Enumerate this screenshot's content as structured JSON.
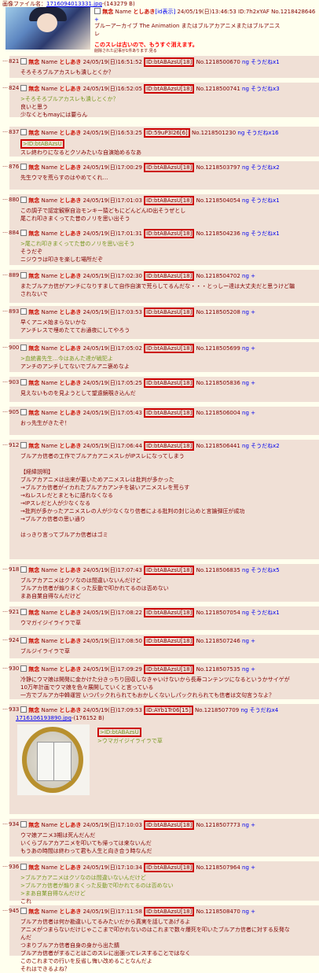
{
  "top": {
    "file_label": "画像ファイル名：",
    "file_link": "1716094013331.jpg",
    "file_size": "-(143279 B)"
  },
  "op": {
    "checkbox": "",
    "subject": "無念",
    "name_label": "Name",
    "name": "としあき",
    "id_show": "[id表示]",
    "datetime": "24/05/19(日)13:46:53",
    "id": "ID:7h2xYAF",
    "no": "No.1218428646",
    "sodane": "+",
    "body_line1": "ブルーアーカイブ The Animation またはブルアカアニメまたはブルアニス",
    "body_line2": "レ",
    "warning": "このスレは古いので、もうすぐ消えます。",
    "small_note": "削除された記事が1件あります.見る"
  },
  "posts": [
    {
      "dots": "…",
      "num": "821",
      "subject": "無念",
      "name_label": "Name",
      "name": "としあき",
      "datetime": "24/05/19(日)16:51:52",
      "id": "ID:btABAzsU[18]",
      "no": "No.1218500670",
      "sodane": "ng",
      "sodane_label": "そうだねx1",
      "lines": [
        {
          "t": "そろそろブルアカスレも潰しとくか？",
          "q": false
        }
      ]
    },
    {
      "dots": "…",
      "num": "824",
      "subject": "無念",
      "name_label": "Name",
      "name": "としあき",
      "datetime": "24/05/19(日)16:52:05",
      "id": "ID:btABAzsU[18]",
      "no": "No.1218500741",
      "sodane": "ng",
      "sodane_label": "そうだねx3",
      "lines": [
        {
          "t": ">そろそろブルアカスレも潰しとくか？",
          "q": true
        },
        {
          "t": "良いと思う",
          "q": false
        },
        {
          "t": "少なくともmayには要らん",
          "q": false
        }
      ]
    },
    {
      "dots": "…",
      "num": "837",
      "subject": "無念",
      "name_label": "Name",
      "name": "としあき",
      "datetime": "24/05/19(日)16:53:25",
      "id": "ID:59uP3l26[6]",
      "no": "No.1218501230",
      "sodane": "ng",
      "sodane_label": "そうだねx16",
      "quote_id": ">ID:btABAzsU",
      "lines": [
        {
          "t": "スレ終わりになるとクソみたいな自演始めるなあ",
          "q": false
        }
      ]
    },
    {
      "dots": "…",
      "num": "876",
      "subject": "無念",
      "name_label": "Name",
      "name": "としあき",
      "datetime": "24/05/19(日)17:00:29",
      "id": "ID:btABAzsU[18]",
      "no": "No.1218503797",
      "sodane": "ng",
      "sodane_label": "そうだねx2",
      "lines": [
        {
          "t": "先生ウマを荒らすのはやめてくれ…",
          "q": false
        }
      ]
    },
    {
      "dots": "…",
      "num": "880",
      "subject": "無念",
      "name_label": "Name",
      "name": "としあき",
      "datetime": "24/05/19(日)17:01:03",
      "id": "ID:btABAzsU[18]",
      "no": "No.1218504054",
      "sodane": "ng",
      "sodane_label": "そうだねx1",
      "lines": [
        {
          "t": "この調子で認定観察自治モンキー猿どもにどんどんID出そうぜとし",
          "q": false
        },
        {
          "t": "尾これ叩きまくってた昔のノリを思い出そう",
          "q": false
        }
      ]
    },
    {
      "dots": "…",
      "num": "884",
      "subject": "無念",
      "name_label": "Name",
      "name": "としあき",
      "datetime": "24/05/19(日)17:01:31",
      "id": "ID:btABAzsU[18]",
      "no": "No.1218504236",
      "sodane": "ng",
      "sodane_label": "そうだねx1",
      "lines": [
        {
          "t": ">尾これ叩きまくってた昔のノリを思い出そう",
          "q": true
        },
        {
          "t": "そうだぞ",
          "q": false
        },
        {
          "t": "ニジウラは叩きを楽しむ場所だぞ",
          "q": false
        }
      ]
    },
    {
      "dots": "…",
      "num": "889",
      "subject": "無念",
      "name_label": "Name",
      "name": "としあき",
      "datetime": "24/05/19(日)17:02:30",
      "id": "ID:btABAzsU[18]",
      "no": "No.1218504702",
      "sodane": "ng",
      "sodane_label": "+",
      "lines": [
        {
          "t": "またブルアカ信がアンチになりすまして自作自演で荒らしてるんだな・・・とっしー達は大丈夫だと思うけど騙",
          "q": false
        },
        {
          "t": "されないで",
          "q": false
        }
      ]
    },
    {
      "dots": "…",
      "num": "893",
      "subject": "無念",
      "name_label": "Name",
      "name": "としあき",
      "datetime": "24/05/19(日)17:03:53",
      "id": "ID:btABAzsU[18]",
      "no": "No.1218505208",
      "sodane": "ng",
      "sodane_label": "+",
      "lines": [
        {
          "t": "早くアニメ始まらないかな",
          "q": false
        },
        {
          "t": "アンチレスで埋めたててお通夜にしてやろう",
          "q": false
        }
      ]
    },
    {
      "dots": "…",
      "num": "900",
      "subject": "無念",
      "name_label": "Name",
      "name": "としあき",
      "datetime": "24/05/19(日)17:05:02",
      "id": "ID:btABAzsU[18]",
      "no": "No.1218505699",
      "sodane": "ng",
      "sodane_label": "+",
      "lines": [
        {
          "t": ">血統書先生…今はあんた達が戦犯よ",
          "q": true
        },
        {
          "t": "アンチのアンチしてないでブルアニ褒めなよ",
          "q": false
        }
      ]
    },
    {
      "dots": "…",
      "num": "903",
      "subject": "無念",
      "name_label": "Name",
      "name": "としあき",
      "datetime": "24/05/19(日)17:05:25",
      "id": "ID:btABAzsU[18]",
      "no": "No.1218505836",
      "sodane": "ng",
      "sodane_label": "+",
      "lines": [
        {
          "t": "見えないものを見ようとして望遠鏡覗き込んだ",
          "q": false
        }
      ]
    },
    {
      "dots": "…",
      "num": "905",
      "subject": "無念",
      "name_label": "Name",
      "name": "としあき",
      "datetime": "24/05/19(日)17:05:43",
      "id": "ID:btABAzsU[18]",
      "no": "No.1218506004",
      "sodane": "ng",
      "sodane_label": "+",
      "lines": [
        {
          "t": "おっ先生がきたぞ！",
          "q": false
        }
      ]
    },
    {
      "dots": "…",
      "num": "912",
      "subject": "無念",
      "name_label": "Name",
      "name": "としあき",
      "datetime": "24/05/19(日)17:06:44",
      "id": "ID:btABAzsU[18]",
      "no": "No.1218506441",
      "sodane": "ng",
      "sodane_label": "そうだねx2",
      "lines": [
        {
          "t": "ブルアカ信者の工作でブルアカアニメスレがIPスレになってしまう",
          "q": false
        },
        {
          "t": "",
          "q": false
        },
        {
          "t": "【経緯説明】",
          "q": false
        },
        {
          "t": "ブルアカアニメは出来が悪いためアニメスレは批判が多かった",
          "q": false
        },
        {
          "t": "→ブルアカ信者がイカれたブルアカアンチを装いアニメスレを荒らす",
          "q": false
        },
        {
          "t": "→ねレスレだとまともに語れなくなる",
          "q": false
        },
        {
          "t": "→IPスレだと人が少なくなる",
          "q": false
        },
        {
          "t": "→批判が多かったアニメスレの人が少なくなり信者による批判の封じ込めと言論弾圧が成功",
          "q": false
        },
        {
          "t": "→ブルアカ信者の思い通り",
          "q": false
        },
        {
          "t": "",
          "q": false
        },
        {
          "t": "はっきり言ってブルアカ信者はゴミ",
          "q": false
        }
      ]
    },
    {
      "dots": "…",
      "num": "918",
      "subject": "無念",
      "name_label": "Name",
      "name": "としあき",
      "datetime": "24/05/19(日)17:07:43",
      "id": "ID:btABAzsU[18]",
      "no": "No.1218506835",
      "sodane": "ng",
      "sodane_label": "そうだねx5",
      "lines": [
        {
          "t": "ブルアカアニメはクソなのは間違いないんだけど",
          "q": false
        },
        {
          "t": "ブルアカ信者が煽りまくった反動で叩かれてるのは否めない",
          "q": false
        },
        {
          "t": "まあ自業自得なんだけど",
          "q": false
        }
      ]
    },
    {
      "dots": "…",
      "num": "921",
      "subject": "無念",
      "name_label": "Name",
      "name": "としあき",
      "datetime": "24/05/19(日)17:08:22",
      "id": "ID:btABAzsU[18]",
      "no": "No.1218507054",
      "sodane": "ng",
      "sodane_label": "そうだねx1",
      "lines": [
        {
          "t": "ウマガイジイライラで草",
          "q": false
        }
      ]
    },
    {
      "dots": "…",
      "num": "924",
      "subject": "無念",
      "name_label": "Name",
      "name": "としあき",
      "datetime": "24/05/19(日)17:08:50",
      "id": "ID:btABAzsU[18]",
      "no": "No.1218507246",
      "sodane": "ng",
      "sodane_label": "+",
      "lines": [
        {
          "t": "ブルジイライラで草",
          "q": false
        }
      ]
    },
    {
      "dots": "…",
      "num": "930",
      "subject": "無念",
      "name_label": "Name",
      "name": "としあき",
      "datetime": "24/05/19(日)17:09:29",
      "id": "ID:btABAzsU[18]",
      "no": "No.1218507535",
      "sodane": "ng",
      "sodane_label": "+",
      "lines": [
        {
          "t": "冷静にウマ娘は開発に金かけた分きっちり回収しなきゃいけないから長寿コンテンツになるというかサイゲが",
          "q": false
        },
        {
          "t": "10万年計画でウマ娘を色々展開していくと言っている",
          "q": false
        },
        {
          "t": "一方でブルアカ中韓運営 いつパックれられてもおかしくないしパックれられても信者は文句言うなよ？",
          "q": false
        }
      ]
    },
    {
      "dots": "…",
      "num": "933",
      "subject": "無念",
      "name_label": "Name",
      "name": "としあき",
      "datetime": "24/05/19(日)17:09:53",
      "id": "ID:AYb1Tr06[15]",
      "no": "No.1218507709",
      "sodane": "ng",
      "sodane_label": "そうだねx4",
      "file_link": "1716106193890.jpg",
      "file_size": "-(176152 B)",
      "quote_id": ">ID:btABAzsU",
      "lines": [
        {
          "t": ">ウマガイジイライラで草",
          "q": true
        }
      ]
    },
    {
      "dots": "…",
      "num": "934",
      "subject": "無念",
      "name_label": "Name",
      "name": "としあき",
      "datetime": "24/05/19(日)17:10:03",
      "id": "ID:btABAzsU[18]",
      "no": "No.1218507773",
      "sodane": "ng",
      "sodane_label": "+",
      "lines": [
        {
          "t": "ウマ娘アニメ3期は死んだんだ",
          "q": false
        },
        {
          "t": "いくらブルアカアニメを叩いても帰っては来ないんだ",
          "q": false
        },
        {
          "t": "もうあの時間は終わって君も人生と向き合う時なんだ",
          "q": false
        }
      ]
    },
    {
      "dots": "…",
      "num": "936",
      "subject": "無念",
      "name_label": "Name",
      "name": "としあき",
      "datetime": "24/05/19(日)17:10:34",
      "id": "ID:btABAzsU[18]",
      "no": "No.1218507964",
      "sodane": "ng",
      "sodane_label": "+",
      "lines": [
        {
          "t": ">ブルアカアニメはクソなのは間違いないんだけど",
          "q": true
        },
        {
          "t": ">ブルアカ信者が煽りまくった反動で叩かれてるのは否めない",
          "q": true
        },
        {
          "t": ">まあ自業自得なんだけど",
          "q": true
        },
        {
          "t": "これ",
          "q": false
        }
      ]
    },
    {
      "dots": "…",
      "num": "945",
      "subject": "無念",
      "name_label": "Name",
      "name": "としあき",
      "datetime": "24/05/19(日)17:11:58",
      "id": "ID:btABAzsU[18]",
      "no": "No.1218508470",
      "sodane": "ng",
      "sodane_label": "+",
      "lines": [
        {
          "t": "ブルアカ信者は何か勘違いしてるみたいだから真実を話してあげるよ",
          "q": false
        },
        {
          "t": "アニメがつまらないだけじゃここまで叩かれないのはこれまで数々爆死を叩いたブルアカ信者に対する反発な",
          "q": false
        },
        {
          "t": "んだ",
          "q": false
        },
        {
          "t": "つまりブルアカ信者自身の身から出た錆",
          "q": false
        },
        {
          "t": "ブルアカ信者がすることはこのスレに出張ってレスすることではなく",
          "q": false
        },
        {
          "t": "このこれまでの行いを反省し悔い改めることなんだよ",
          "q": false
        },
        {
          "t": "それはできるよね？",
          "q": false
        }
      ]
    }
  ]
}
